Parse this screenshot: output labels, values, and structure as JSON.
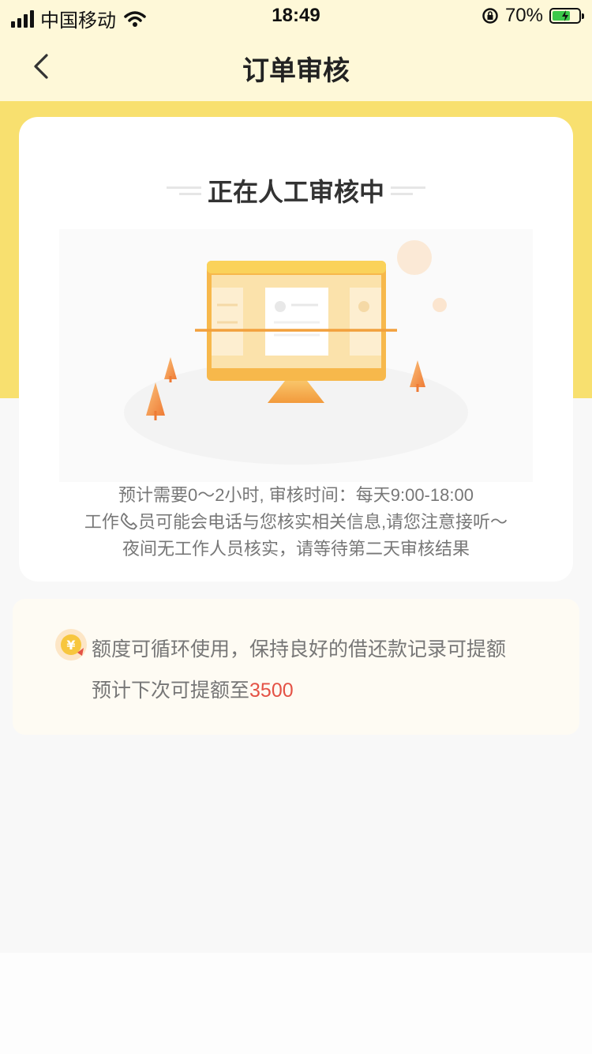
{
  "status_bar": {
    "carrier": "中国移动",
    "time": "18:49",
    "battery": "70%",
    "battery_level": 0.7
  },
  "nav": {
    "title": "订单审核",
    "back_icon": "chevron-left-icon"
  },
  "card": {
    "status_title": "正在人工审核中",
    "illustration": "monitor-review-illustration",
    "info_lines": [
      "预计需要0～2小时, 审核时间：每天9:00-18:00",
      "员可能会电话与您核实相关信息,请您注意接听～",
      "夜间无工作人员核实，请等待第二天审核结果"
    ],
    "info_line2_prefix": "工作",
    "info_line2_icon": "phone-icon"
  },
  "promo": {
    "icon": "yuan-coin-icon",
    "line1": "额度可循环使用，保持良好的借还款记录可提额",
    "line2_prefix": "预计下次可提额至",
    "line2_amount": "3500"
  },
  "colors": {
    "header_bg": "#fef8d8",
    "band_yellow": "#f8e06f",
    "accent_red": "#e45245",
    "monitor_orange": "#f7b84b"
  }
}
